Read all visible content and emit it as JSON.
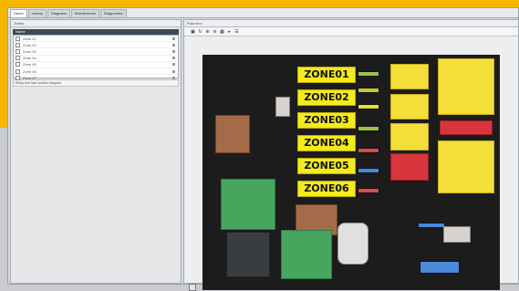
{
  "window_tabs": [
    "Home",
    "Library",
    "Diagrams",
    "Maintenance",
    "Diagnostics"
  ],
  "left_panel": {
    "title": "Zones",
    "header": "Name",
    "items": [
      "Zone 01",
      "Zone 02",
      "Zone 03",
      "Zone 04",
      "Zone 05",
      "Zone 06",
      "Zone 07"
    ],
    "status": "Relay and fuse location diagram"
  },
  "right_panel": {
    "title": "Fuse box"
  },
  "toolbar": {
    "icons": [
      "save-icon",
      "refresh-icon",
      "zoom-in-icon",
      "zoom-out-icon",
      "grid-icon",
      "nav-icon",
      "menu-icon"
    ]
  },
  "zones": [
    {
      "label": "ZONE01"
    },
    {
      "label": "ZONE02"
    },
    {
      "label": "ZONE03"
    },
    {
      "label": "ZONE04"
    },
    {
      "label": "ZONE05"
    },
    {
      "label": "ZONE06"
    }
  ],
  "colors": {
    "accent": "#f5b700",
    "zone_label_bg": "#f4ea1d",
    "list_header_bg": "#3d4a57"
  }
}
